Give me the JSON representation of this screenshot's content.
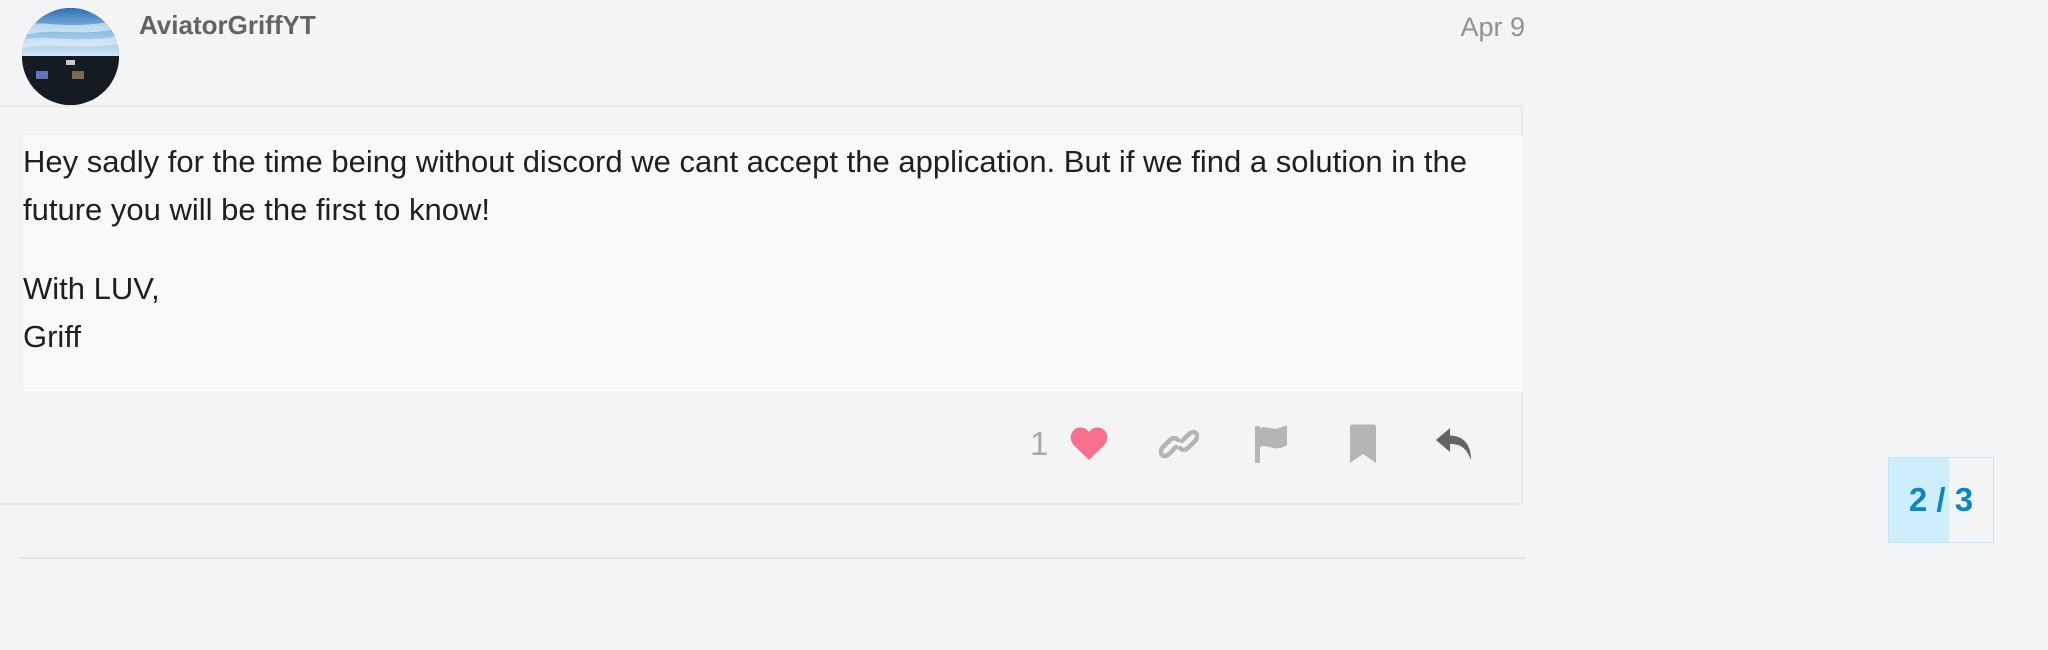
{
  "post": {
    "username": "AviatorGriffYT",
    "date": "Apr 9",
    "paragraph1": "Hey sadly for the time being without discord we cant accept the application. But if we find a solution in the future you will be the first to know!",
    "signoff": "With LUV,",
    "signature": "Griff"
  },
  "actions": {
    "like_count": "1",
    "icons": [
      "heart-icon",
      "link-icon",
      "flag-icon",
      "bookmark-icon",
      "reply-icon"
    ],
    "like_color": "#f96f8e",
    "icon_color": "#b5b5b5",
    "reply_color": "#646464"
  },
  "timeline": {
    "label": "2 / 3",
    "progress": 0.58,
    "accent_color": "#0a86c4"
  }
}
